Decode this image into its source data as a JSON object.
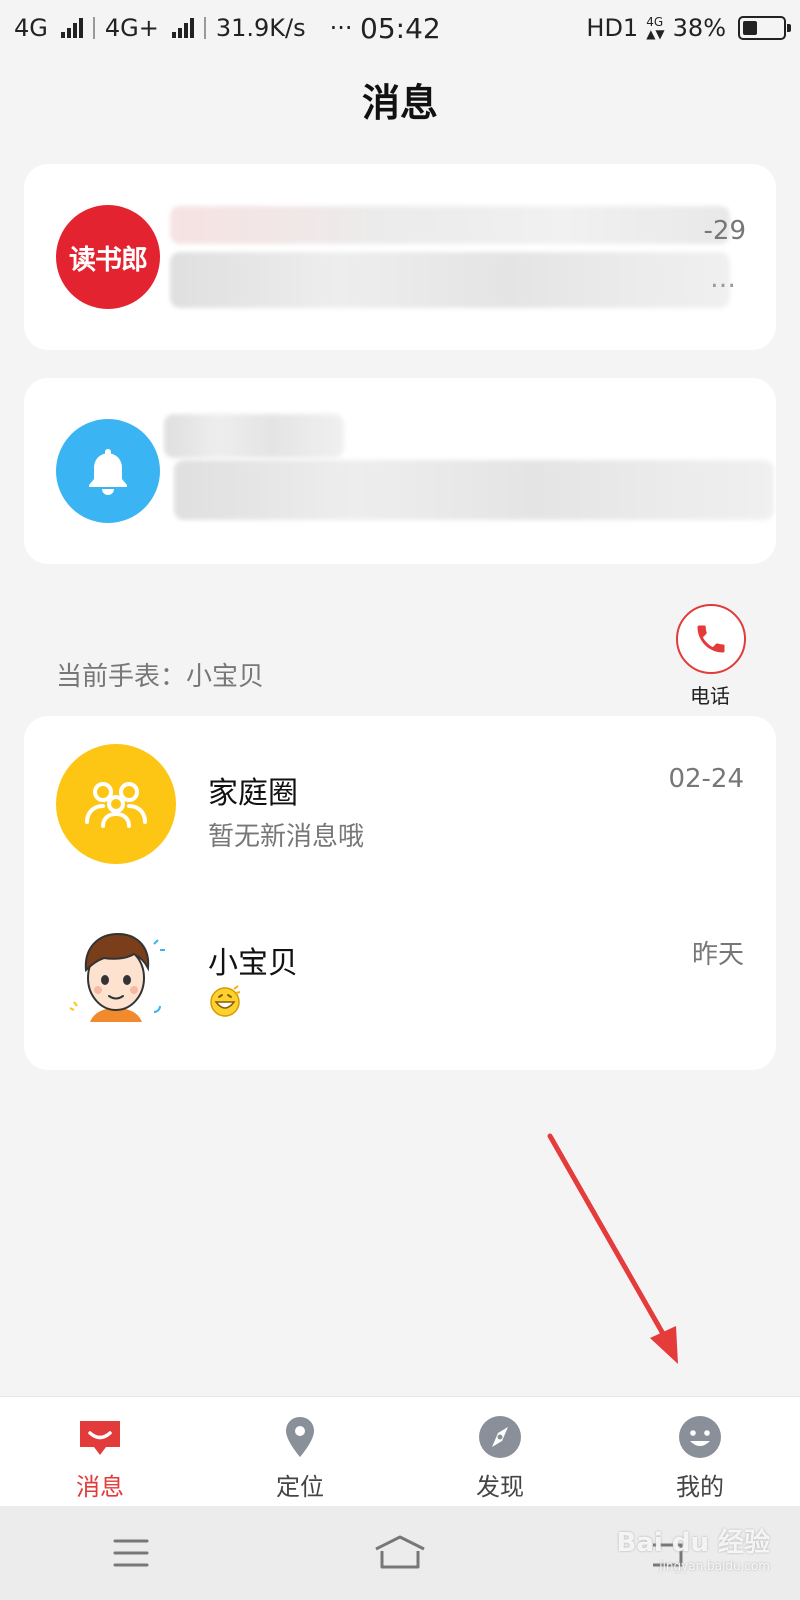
{
  "status_bar": {
    "network1": "4G",
    "network2": "4G+",
    "speed": "31.9K/s",
    "more": "···",
    "time": "05:42",
    "hd": "HD1",
    "battery": "38%",
    "battery_level": 0.38
  },
  "header": {
    "title": "消息"
  },
  "system_cards": [
    {
      "logo_text": "读书郎",
      "date": "-29",
      "ellipsis": "…",
      "color": "#e42330"
    },
    {
      "icon": "bell-icon",
      "color": "#3ab4f2"
    }
  ],
  "current_watch": {
    "label": "当前手表：小宝贝"
  },
  "call": {
    "label": "电话",
    "icon": "phone-icon",
    "color": "#e33a3a"
  },
  "conversations": [
    {
      "name": "家庭圈",
      "preview": "暂无新消息哦",
      "time": "02-24",
      "icon": "family-icon",
      "color": "#fdc614"
    },
    {
      "name": "小宝贝",
      "preview": "",
      "time": "昨天",
      "icon": "child-avatar"
    }
  ],
  "bottom_nav": [
    {
      "label": "消息",
      "icon": "message-icon",
      "active": true
    },
    {
      "label": "定位",
      "icon": "location-pin-icon",
      "active": false
    },
    {
      "label": "发现",
      "icon": "compass-icon",
      "active": false
    },
    {
      "label": "我的",
      "icon": "smiley-icon",
      "active": false
    }
  ],
  "watermark": {
    "brand": "Bai du 经验",
    "url": "jingyan.baidu.com"
  },
  "accent_color": "#e33a3a"
}
